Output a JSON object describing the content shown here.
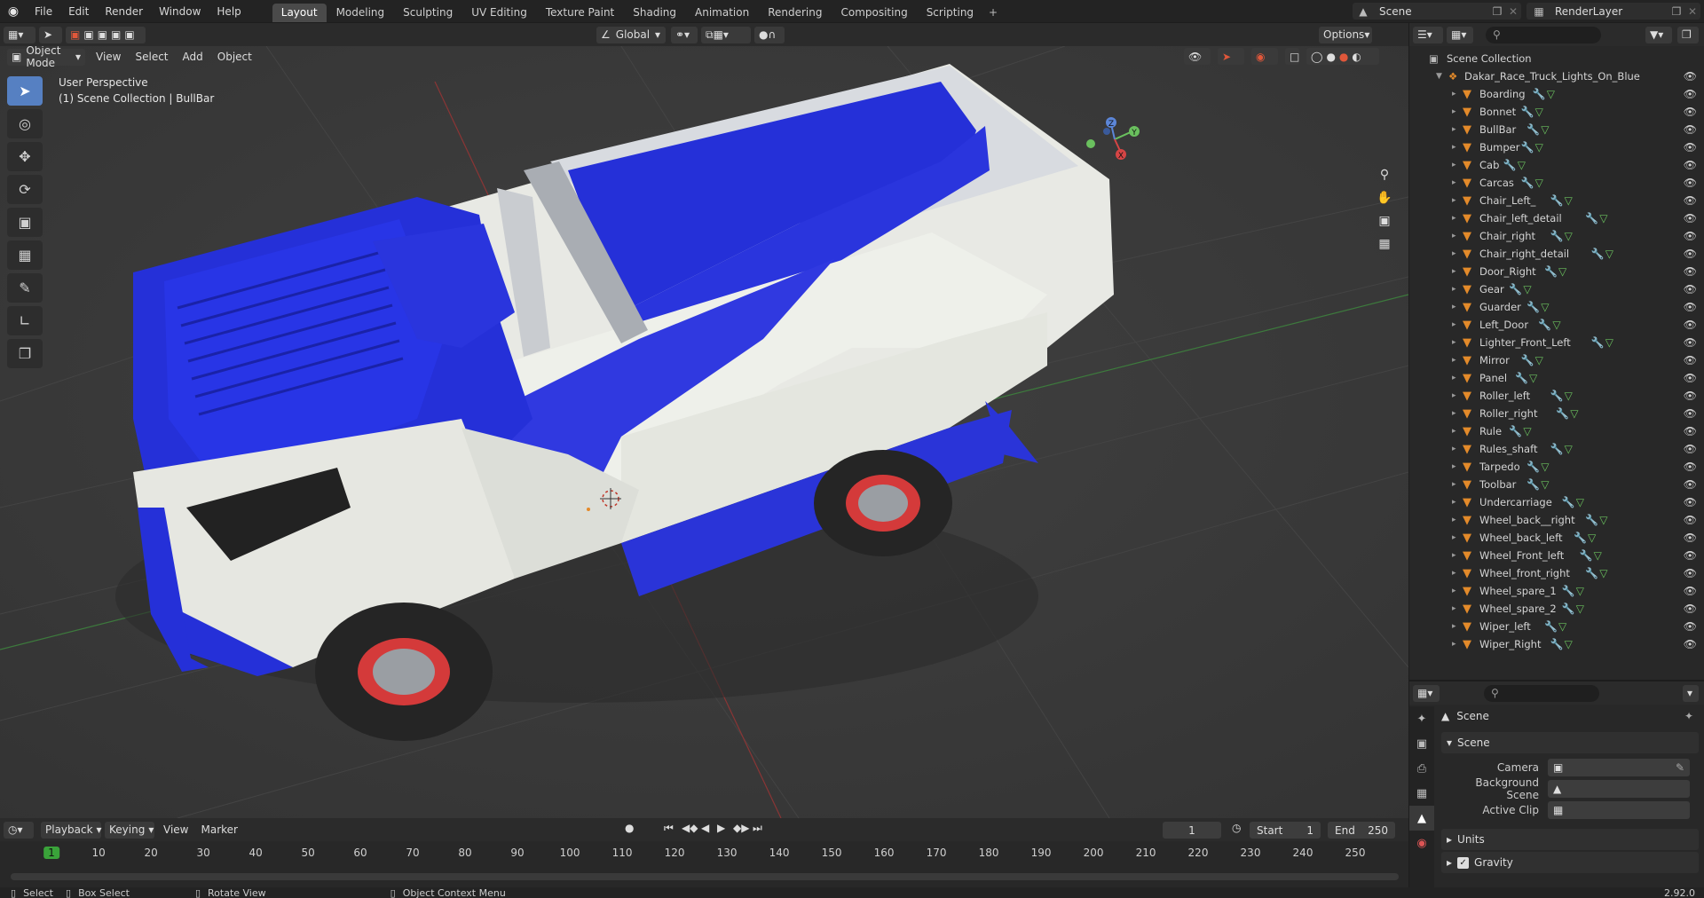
{
  "topbar": {
    "menu": [
      "File",
      "Edit",
      "Render",
      "Window",
      "Help"
    ],
    "workspaces": [
      "Layout",
      "Modeling",
      "Sculpting",
      "UV Editing",
      "Texture Paint",
      "Shading",
      "Animation",
      "Rendering",
      "Compositing",
      "Scripting"
    ],
    "active_workspace": "Layout",
    "scene_name": "Scene",
    "view_layer": "RenderLayer"
  },
  "viewport_header": {
    "mode": "Object Mode",
    "menus": [
      "View",
      "Select",
      "Add",
      "Object"
    ],
    "orientation": "Global",
    "options_label": "Options"
  },
  "viewport": {
    "perspective_label": "User Perspective",
    "context_label": "(1) Scene Collection | BullBar",
    "axis_labels": [
      "X",
      "Y",
      "Z"
    ]
  },
  "outliner": {
    "root": "Scene Collection",
    "collection": "Dakar_Race_Truck_Lights_On_Blue",
    "items": [
      "Boarding",
      "Bonnet",
      "BullBar",
      "Bumper",
      "Cab",
      "Carcas",
      "Chair_Left_",
      "Chair_left_detail",
      "Chair_right",
      "Chair_right_detail",
      "Door_Right",
      "Gear",
      "Guarder",
      "Left_Door",
      "Lighter_Front_Left",
      "Mirror",
      "Panel",
      "Roller_left",
      "Roller_right",
      "Rule",
      "Rules_shaft",
      "Tarpedo",
      "Toolbar",
      "Undercarriage",
      "Wheel_back__right",
      "Wheel_back_left",
      "Wheel_Front_left",
      "Wheel_front_right",
      "Wheel_spare_1",
      "Wheel_spare_2",
      "Wiper_left",
      "Wiper_Right"
    ]
  },
  "properties": {
    "context": "Scene",
    "panel_scene": "Scene",
    "camera_label": "Camera",
    "background_scene_label": "Background Scene",
    "active_clip_label": "Active Clip",
    "units_label": "Units",
    "gravity_label": "Gravity",
    "gravity_checked": true
  },
  "timeline": {
    "menus": [
      "Playback",
      "Keying",
      "View",
      "Marker"
    ],
    "current_frame": "1",
    "start_label": "Start",
    "start": "1",
    "end_label": "End",
    "end": "250",
    "ticks": [
      "1",
      "10",
      "20",
      "30",
      "40",
      "50",
      "60",
      "70",
      "80",
      "90",
      "100",
      "110",
      "120",
      "130",
      "140",
      "150",
      "160",
      "170",
      "180",
      "190",
      "200",
      "210",
      "220",
      "230",
      "240",
      "250"
    ]
  },
  "statusbar": {
    "select": "Select",
    "box_select": "Box Select",
    "rotate_view": "Rotate View",
    "context_menu": "Object Context Menu",
    "version": "2.92.0"
  },
  "colors": {
    "accent": "#5680c2",
    "truck_blue": "#2530d8",
    "truck_white": "#e8e9e4",
    "wheel_red": "#d43a3a"
  }
}
